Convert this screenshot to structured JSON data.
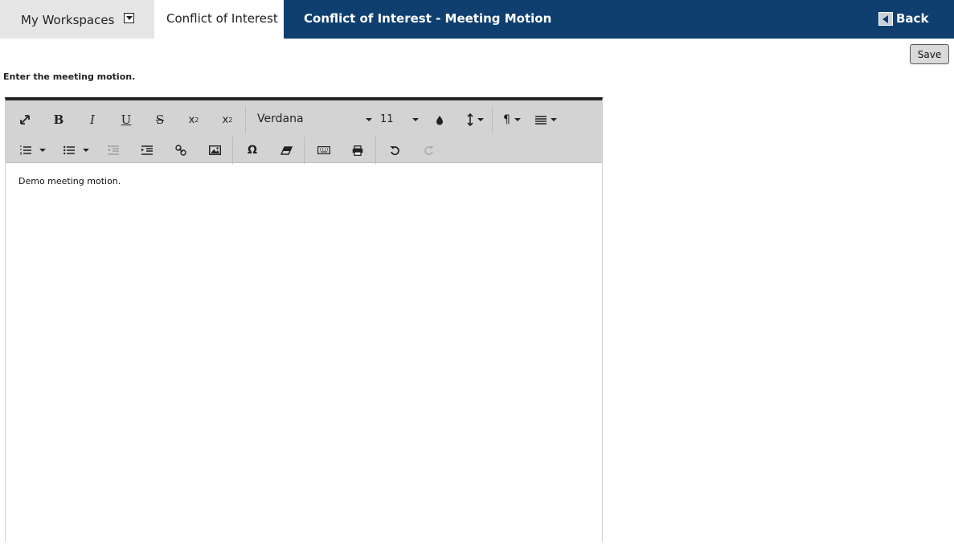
{
  "nav": {
    "workspaces_label": "My Workspaces",
    "coi_tab_label": "Conflict of Interest",
    "page_heading": "Conflict of Interest - Meeting Motion",
    "back_label": "Back"
  },
  "toolbar": {
    "save_label": "Save"
  },
  "form": {
    "instruction": "Enter the meeting motion."
  },
  "editor": {
    "font_family": "Verdana",
    "font_size": "11",
    "content": "Demo meeting motion.",
    "buttons_row1": [
      "fullscreen",
      "bold",
      "italic",
      "underline",
      "strikethrough",
      "subscript",
      "superscript",
      "font-family",
      "font-size",
      "text-color",
      "line-height",
      "paragraph-format",
      "align"
    ],
    "buttons_row2": [
      "ordered-list",
      "unordered-list",
      "outdent",
      "indent",
      "link",
      "image",
      "special-characters",
      "clear-formatting",
      "keyboard",
      "print",
      "undo",
      "redo"
    ]
  },
  "colors": {
    "nav_bg": "#0e3f6f",
    "toolbar_bg": "#d3d3d3",
    "workspaces_bg": "#e6e6e6"
  }
}
